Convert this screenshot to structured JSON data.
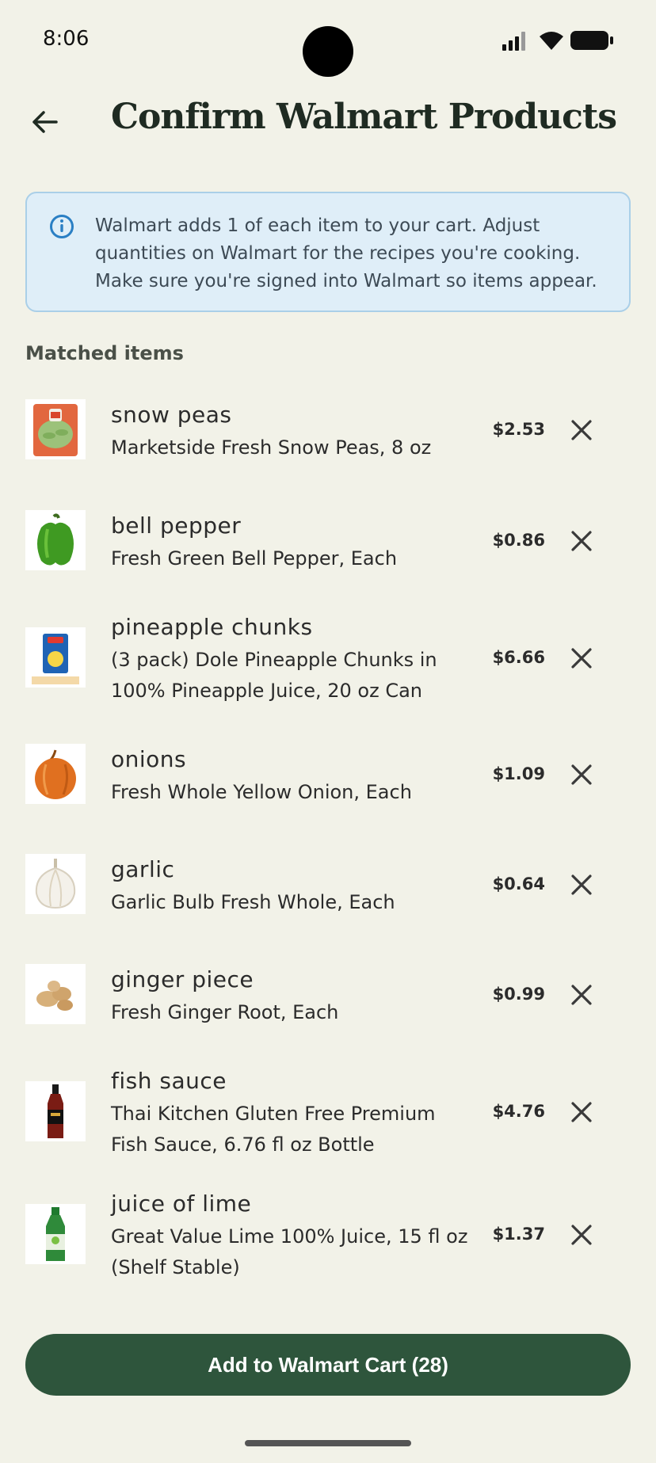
{
  "status_bar": {
    "time": "8:06"
  },
  "header": {
    "title": "Confirm Walmart Products"
  },
  "info_banner": {
    "text": "Walmart adds 1 of each item to your cart. Adjust quantities on Walmart for the recipes you're cooking. Make sure you're signed into Walmart so items appear."
  },
  "section_label": "Matched items",
  "items": [
    {
      "name": "snow peas",
      "description": "Marketside Fresh Snow Peas, 8 oz",
      "price": "$2.53",
      "thumb_icon": "snow-peas-bag-image"
    },
    {
      "name": "bell pepper",
      "description": "Fresh Green Bell Pepper, Each",
      "price": "$0.86",
      "thumb_icon": "green-bell-pepper-image"
    },
    {
      "name": "pineapple chunks",
      "description": "(3 pack) Dole Pineapple Chunks in 100% Pineapple Juice, 20 oz Can",
      "price": "$6.66",
      "thumb_icon": "pineapple-can-image"
    },
    {
      "name": "onions",
      "description": "Fresh Whole Yellow Onion, Each",
      "price": "$1.09",
      "thumb_icon": "yellow-onion-image"
    },
    {
      "name": "garlic",
      "description": "Garlic Bulb Fresh Whole, Each",
      "price": "$0.64",
      "thumb_icon": "garlic-bulb-image"
    },
    {
      "name": "ginger piece",
      "description": "Fresh Ginger Root, Each",
      "price": "$0.99",
      "thumb_icon": "ginger-root-image"
    },
    {
      "name": "fish sauce",
      "description": "Thai Kitchen Gluten Free Premium Fish Sauce, 6.76 fl oz Bottle",
      "price": "$4.76",
      "thumb_icon": "fish-sauce-bottle-image"
    },
    {
      "name": "juice of lime",
      "description": "Great Value Lime 100% Juice, 15 fl oz (Shelf Stable)",
      "price": "$1.37",
      "thumb_icon": "lime-juice-bottle-image"
    }
  ],
  "cta": {
    "label": "Add to Walmart Cart (28)"
  },
  "colors": {
    "background": "#f2f2e8",
    "accent": "#2e553c",
    "info_bg": "#dfeef8",
    "info_border": "#aacfe8",
    "info_icon": "#2a7fc4"
  }
}
